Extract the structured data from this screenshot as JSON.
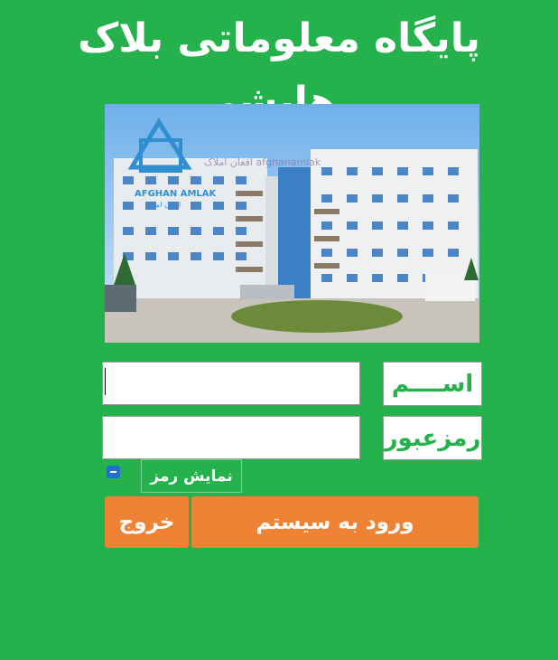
{
  "header": {
    "title": "پایگاه معلوماتی بلاک رهایشی"
  },
  "photo": {
    "logo_text_latin": "AFGHAN AMLAK",
    "logo_text_local": "افغان املاک",
    "watermark": "افغان املاک afghanamlak"
  },
  "form": {
    "name_label": "اســــم",
    "name_value": "",
    "password_label": "رمزعبور",
    "password_value": "",
    "show_password_label": "نمایش رمز",
    "login_label": "ورود به سیستم",
    "exit_label": "خروج"
  },
  "colors": {
    "background": "#25b14c",
    "button": "#ee8235",
    "label_text": "#25b14c",
    "checkbox": "#1f6fd1"
  }
}
